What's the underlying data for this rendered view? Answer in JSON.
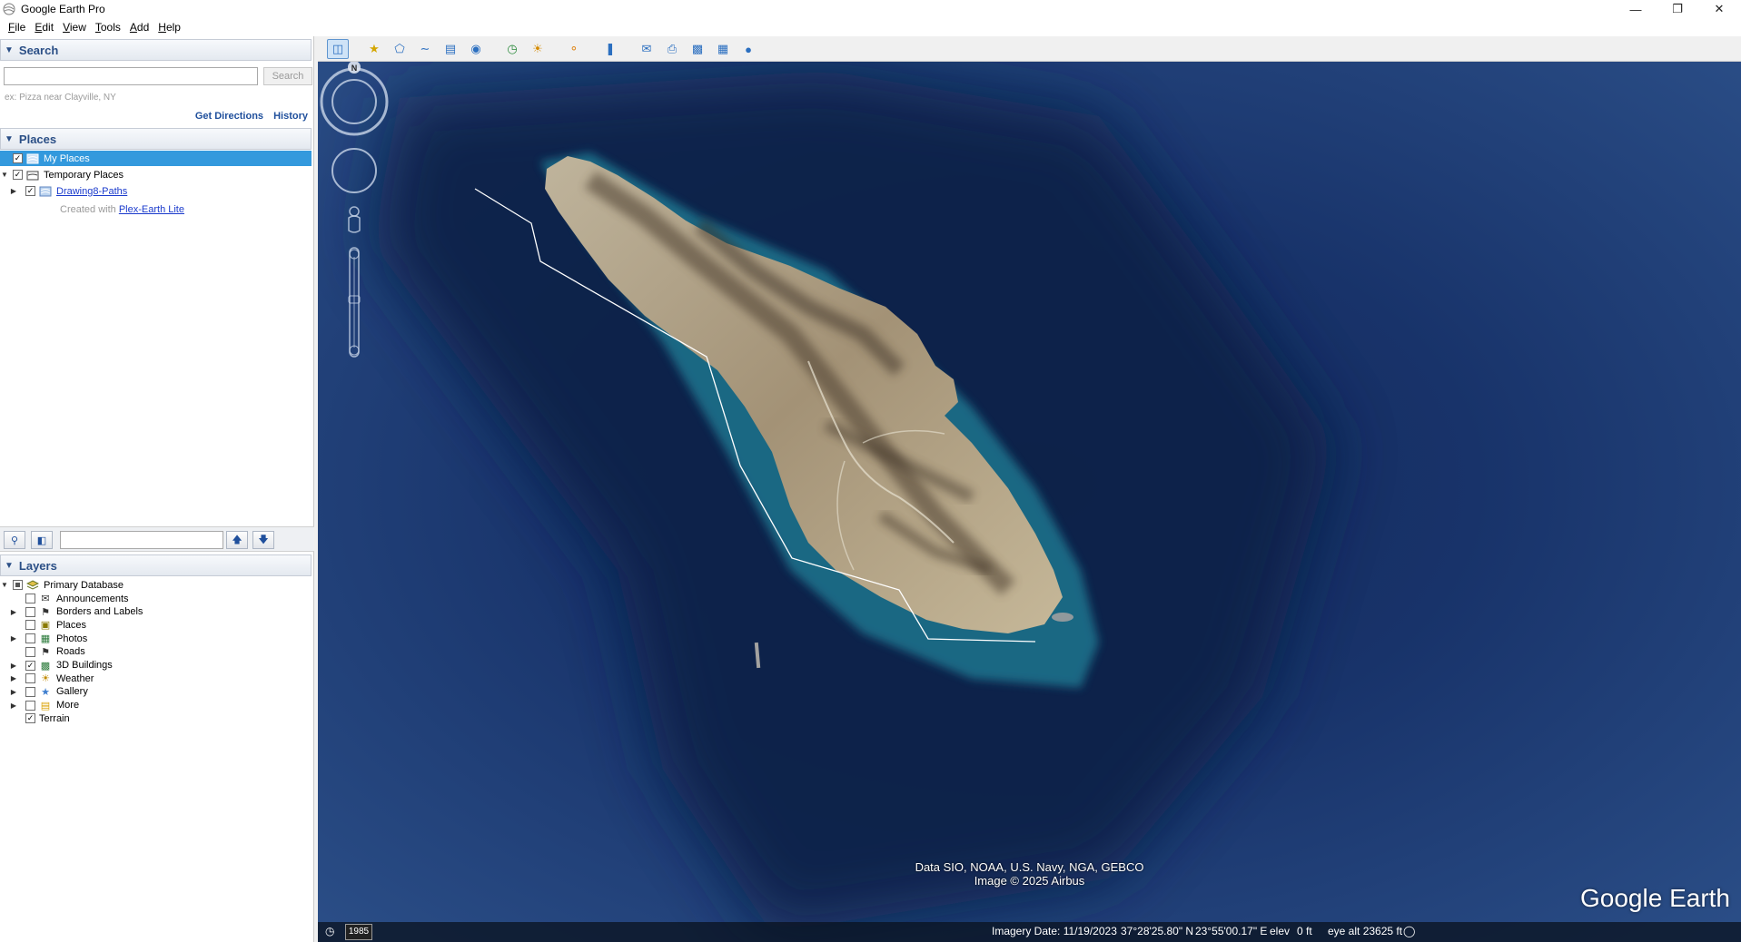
{
  "window": {
    "title": "Google Earth Pro"
  },
  "menu": [
    {
      "label": "File",
      "ul": "F",
      "rest": "ile"
    },
    {
      "label": "Edit",
      "ul": "E",
      "rest": "dit"
    },
    {
      "label": "View",
      "ul": "V",
      "rest": "iew"
    },
    {
      "label": "Tools",
      "ul": "T",
      "rest": "ools"
    },
    {
      "label": "Add",
      "ul": "A",
      "rest": "dd"
    },
    {
      "label": "Help",
      "ul": "H",
      "rest": "elp"
    }
  ],
  "search": {
    "header": "Search",
    "placeholder": "",
    "button": "Search",
    "hint": "ex: Pizza near Clayville, NY",
    "get_directions": "Get Directions",
    "history": "History"
  },
  "places": {
    "header": "Places",
    "my_places": "My Places",
    "temporary_places": "Temporary Places",
    "drawing": "Drawing8-Paths",
    "created_with": "Created with",
    "plex_link": "Plex-Earth Lite"
  },
  "layers": {
    "header": "Layers",
    "root": "Primary Database",
    "items": [
      {
        "label": "Announcements",
        "checked": false,
        "expandable": false,
        "icon": "envelope-icon"
      },
      {
        "label": "Borders and Labels",
        "checked": false,
        "expandable": true,
        "icon": "flag-icon"
      },
      {
        "label": "Places",
        "checked": false,
        "expandable": false,
        "icon": "place-square-icon"
      },
      {
        "label": "Photos",
        "checked": false,
        "expandable": true,
        "icon": "photo-icon"
      },
      {
        "label": "Roads",
        "checked": false,
        "expandable": false,
        "icon": "road-sign-icon"
      },
      {
        "label": "3D Buildings",
        "checked": true,
        "expandable": true,
        "icon": "building-icon"
      },
      {
        "label": "Weather",
        "checked": false,
        "expandable": true,
        "icon": "sun-icon"
      },
      {
        "label": "Gallery",
        "checked": false,
        "expandable": true,
        "icon": "star-icon"
      },
      {
        "label": "More",
        "checked": false,
        "expandable": true,
        "icon": "folder-note-icon"
      },
      {
        "label": "Terrain",
        "checked": true,
        "expandable": false,
        "icon": ""
      }
    ]
  },
  "map": {
    "attribution_line1": "Data SIO, NOAA, U.S. Navy, NGA, GEBCO",
    "attribution_line2": "Image © 2025 Airbus",
    "logo": "Google Earth",
    "year": "1985",
    "imagery_date": "Imagery Date: 11/19/2023",
    "lat": "37°28'25.80\" N",
    "lon": "23°55'00.17\" E",
    "elev_label": "elev",
    "elev": "0 ft",
    "eye_alt": "eye alt  23625 ft",
    "compass_n": "N"
  },
  "colors": {
    "accent": "#2b4f86",
    "selected": "#3399dd",
    "sea_deep": "#0f2550",
    "sea_mid": "#23437a"
  }
}
